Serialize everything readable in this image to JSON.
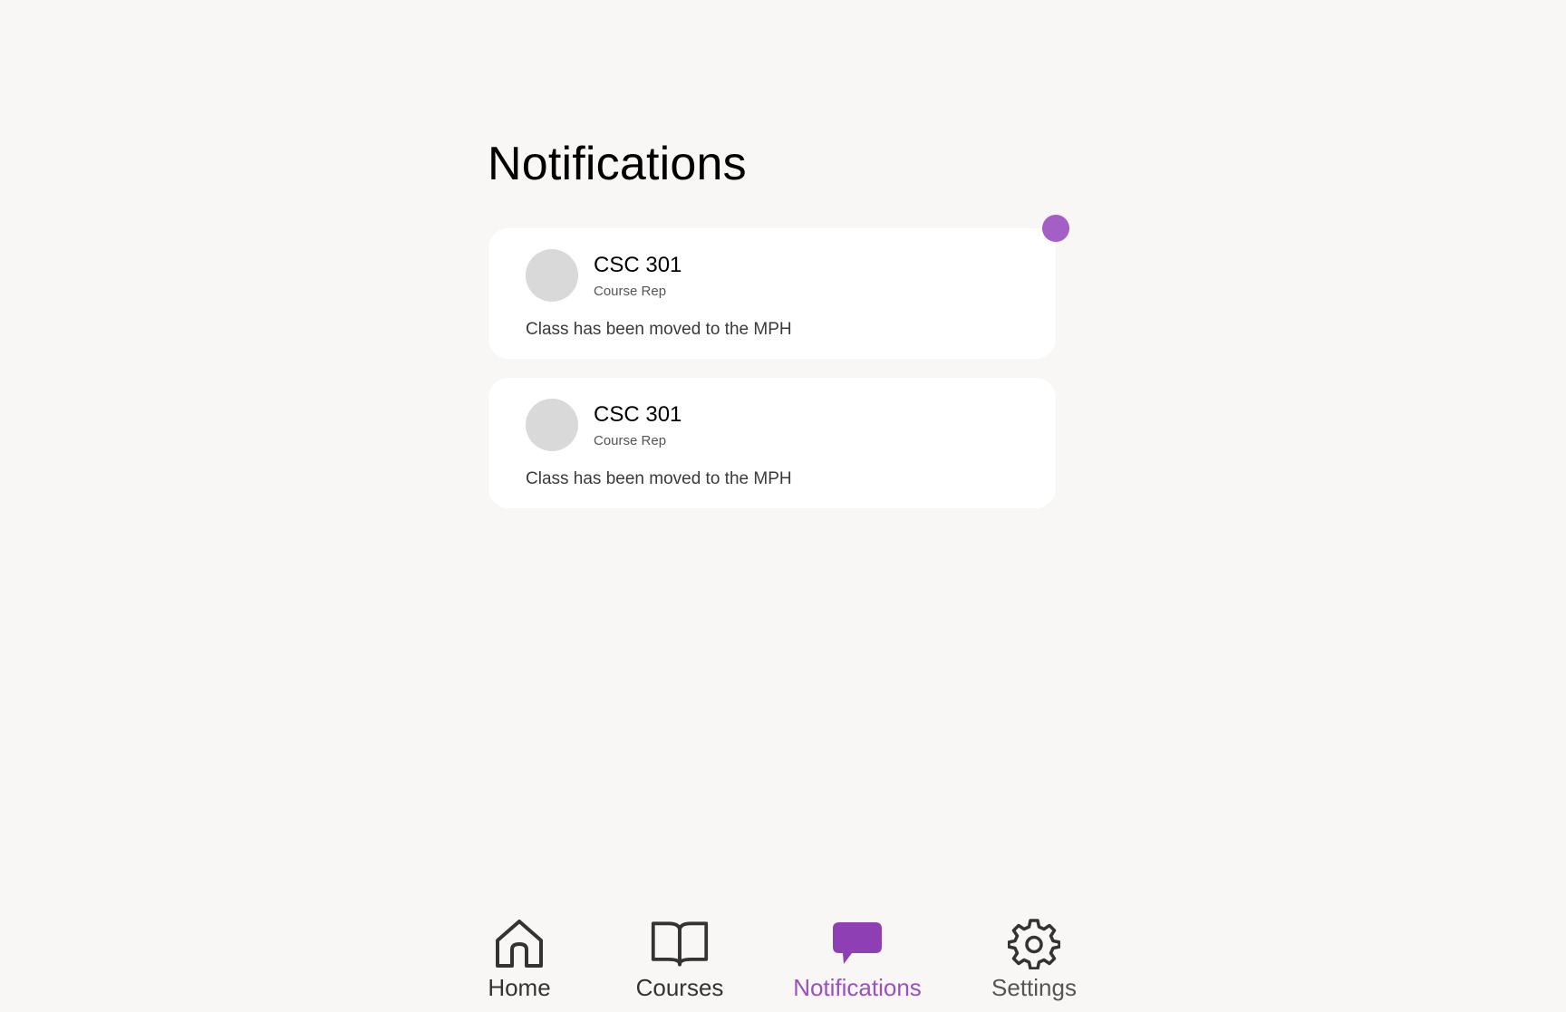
{
  "page": {
    "title": "Notifications"
  },
  "notifications": [
    {
      "title": "CSC 301",
      "subtitle": "Course Rep",
      "message": "Class has been moved to the MPH",
      "unread": true
    },
    {
      "title": "CSC 301",
      "subtitle": "Course Rep",
      "message": "Class has been moved to the MPH",
      "unread": false
    }
  ],
  "nav": {
    "items": [
      {
        "label": "Home",
        "icon": "home-icon",
        "active": false
      },
      {
        "label": "Courses",
        "icon": "book-icon",
        "active": false
      },
      {
        "label": "Notifications",
        "icon": "chat-bubble-icon",
        "active": true
      },
      {
        "label": "Settings",
        "icon": "gear-icon",
        "active": false
      }
    ]
  },
  "colors": {
    "accent": "#a45fc7",
    "active_nav": "#9b4fc0",
    "inactive_nav": "#333333",
    "background": "#f8f7f5",
    "card": "#ffffff",
    "avatar": "#d9d9d9"
  }
}
